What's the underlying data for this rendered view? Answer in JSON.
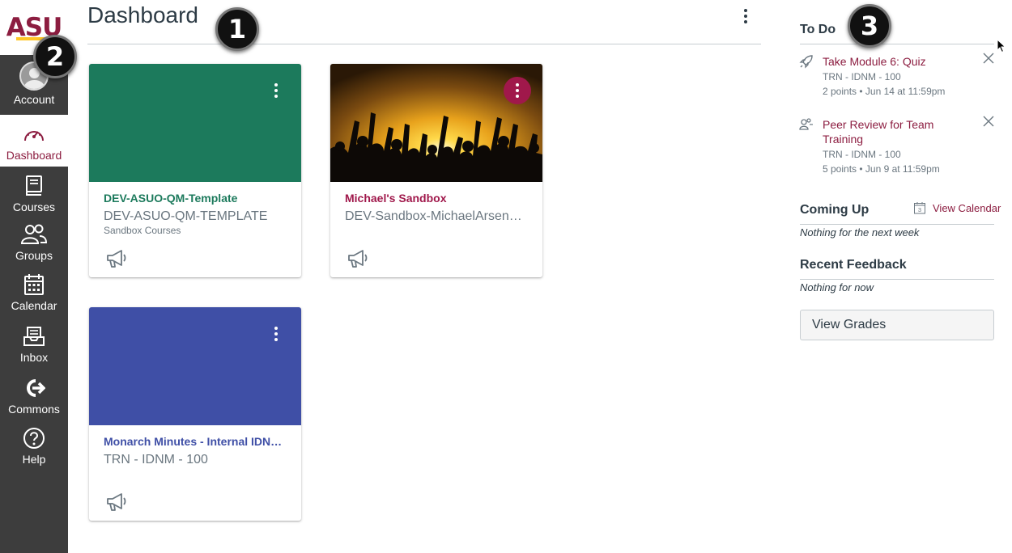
{
  "brand": {
    "logo": "ASU",
    "logo_color": "#8c1d40",
    "accent": "#ffc627"
  },
  "nav": [
    {
      "label": "Account",
      "icon": "account-avatar-icon"
    },
    {
      "label": "Dashboard",
      "icon": "dashboard-gauge-icon",
      "active": true
    },
    {
      "label": "Courses",
      "icon": "courses-book-icon"
    },
    {
      "label": "Groups",
      "icon": "groups-people-icon"
    },
    {
      "label": "Calendar",
      "icon": "calendar-icon"
    },
    {
      "label": "Inbox",
      "icon": "inbox-icon"
    },
    {
      "label": "Commons",
      "icon": "commons-arrow-icon"
    },
    {
      "label": "Help",
      "icon": "help-question-icon"
    }
  ],
  "markers": [
    "1",
    "2",
    "3"
  ],
  "header": {
    "title": "Dashboard"
  },
  "cards": [
    {
      "name": "DEV-ASUO-QM-Template",
      "code": "DEV-ASUO-QM-TEMPLATE",
      "term": "Sandbox Courses",
      "color": "#1c7a5c",
      "name_color": "#1c7a5c"
    },
    {
      "name": "Michael's Sandbox",
      "code": "DEV-Sandbox-MichaelArsen…",
      "term": "",
      "color": "#a0184b",
      "name_color": "#a0184b",
      "image": "sunset-crowd-silhouette"
    },
    {
      "name": "Monarch Minutes - Internal IDNM…",
      "code": "TRN - IDNM - 100",
      "term": "",
      "color": "#3f4fa6",
      "name_color": "#3f4fa6"
    }
  ],
  "todo": {
    "title": "To Do",
    "items": [
      {
        "title": "Take Module 6: Quiz",
        "course": "TRN - IDNM - 100",
        "details": "2 points • Jun 14 at 11:59pm",
        "icon": "quiz-rocket-icon"
      },
      {
        "title": "Peer Review for Team Training",
        "course": "TRN - IDNM - 100",
        "details": "5 points • Jun 9 at 11:59pm",
        "icon": "peer-review-icon"
      }
    ]
  },
  "coming_up": {
    "title": "Coming Up",
    "view_calendar": "View Calendar",
    "calendar_day": "3",
    "empty": "Nothing for the next week"
  },
  "feedback": {
    "title": "Recent Feedback",
    "empty": "Nothing for now"
  },
  "grades_button": "View Grades"
}
